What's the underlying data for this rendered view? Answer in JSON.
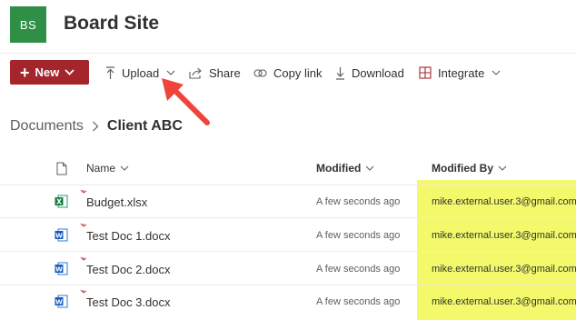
{
  "site": {
    "logo_initials": "BS",
    "logo_color": "#2f8f46",
    "title": "Board Site"
  },
  "toolbar": {
    "new_label": "New",
    "new_color": "#a4262c",
    "upload_label": "Upload",
    "share_label": "Share",
    "copy_link_label": "Copy link",
    "download_label": "Download",
    "integrate_label": "Integrate"
  },
  "breadcrumb": {
    "parent": "Documents",
    "current": "Client ABC"
  },
  "columns": {
    "name": "Name",
    "modified": "Modified",
    "modified_by": "Modified By"
  },
  "files": [
    {
      "name": "Budget.xlsx",
      "type": "excel",
      "modified": "A few seconds ago",
      "modified_by": "mike.external.user.3@gmail.com"
    },
    {
      "name": "Test Doc 1.docx",
      "type": "word",
      "modified": "A few seconds ago",
      "modified_by": "mike.external.user.3@gmail.com"
    },
    {
      "name": "Test Doc 2.docx",
      "type": "word",
      "modified": "A few seconds ago",
      "modified_by": "mike.external.user.3@gmail.com"
    },
    {
      "name": "Test Doc 3.docx",
      "type": "word",
      "modified": "A few seconds ago",
      "modified_by": "mike.external.user.3@gmail.com"
    }
  ],
  "annotation": {
    "arrow_color": "#f0443a",
    "highlight_color": "#f3f96a"
  }
}
